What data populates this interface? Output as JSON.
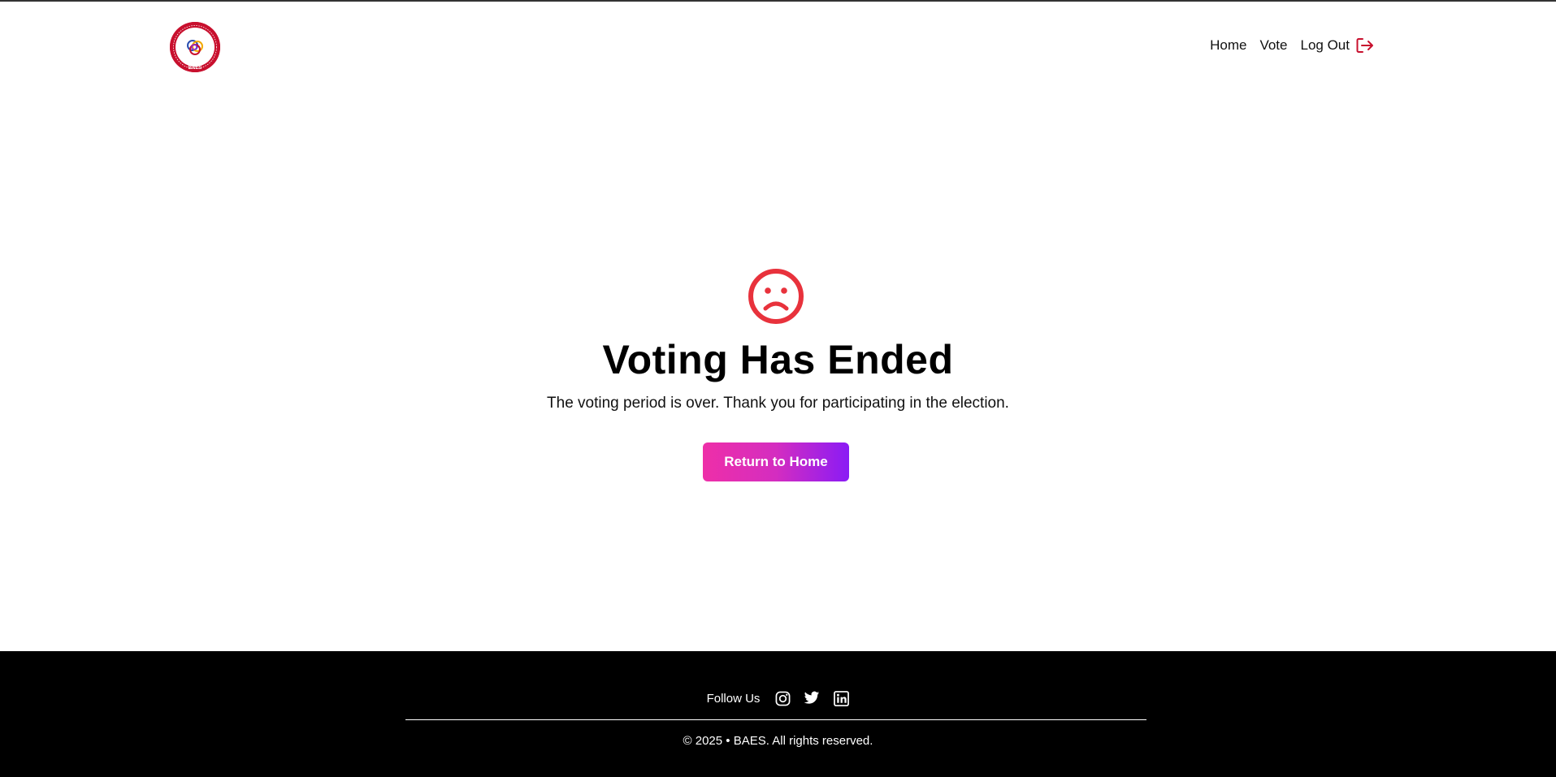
{
  "header": {
    "logo_text": "BAES",
    "nav": {
      "home": "Home",
      "vote": "Vote",
      "logout": "Log Out"
    }
  },
  "main": {
    "icon": "sad-face-icon",
    "title": "Voting Has Ended",
    "message": "The voting period is over. Thank you for participating in the election.",
    "button_label": "Return to Home"
  },
  "footer": {
    "follow_label": "Follow Us",
    "social": [
      "instagram-icon",
      "twitter-icon",
      "linkedin-icon"
    ],
    "copyright": "© 2025 • BAES. All rights reserved."
  },
  "colors": {
    "accent_red": "#e8323c",
    "logo_red": "#c8102e",
    "button_gradient_start": "#ee2fa8",
    "button_gradient_end": "#8a1bf5",
    "footer_bg": "#000000"
  }
}
